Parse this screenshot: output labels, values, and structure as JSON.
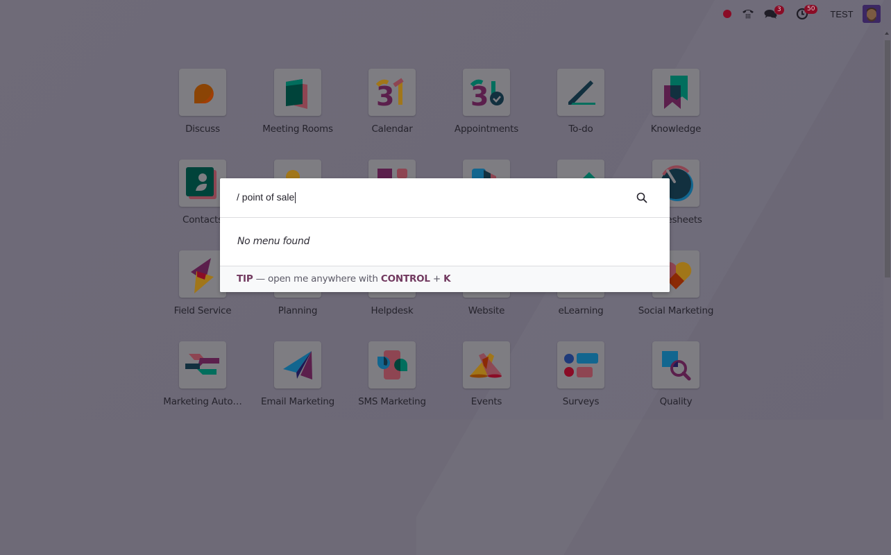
{
  "topbar": {
    "status_dot_color": "#8a0c26",
    "messages_badge": "3",
    "activities_badge": "50",
    "user_name": "TEST"
  },
  "apps": [
    {
      "label": "Discuss",
      "icon": "discuss-icon"
    },
    {
      "label": "Meeting Rooms",
      "icon": "meeting-rooms-icon"
    },
    {
      "label": "Calendar",
      "icon": "calendar-icon"
    },
    {
      "label": "Appointments",
      "icon": "appointments-icon"
    },
    {
      "label": "To-do",
      "icon": "todo-icon"
    },
    {
      "label": "Knowledge",
      "icon": "knowledge-icon"
    },
    {
      "label": "Contacts",
      "icon": "contacts-icon"
    },
    {
      "label": "",
      "icon": "app-icon"
    },
    {
      "label": "",
      "icon": "app-icon"
    },
    {
      "label": "",
      "icon": "app-icon"
    },
    {
      "label": "",
      "icon": "app-icon"
    },
    {
      "label": "Timesheets",
      "icon": "timesheets-icon"
    },
    {
      "label": "Field Service",
      "icon": "field-service-icon"
    },
    {
      "label": "Planning",
      "icon": "planning-icon"
    },
    {
      "label": "Helpdesk",
      "icon": "helpdesk-icon"
    },
    {
      "label": "Website",
      "icon": "website-icon"
    },
    {
      "label": "eLearning",
      "icon": "elearning-icon"
    },
    {
      "label": "Social Marketing",
      "icon": "social-marketing-icon"
    },
    {
      "label": "Marketing Auto…",
      "icon": "marketing-automation-icon"
    },
    {
      "label": "Email Marketing",
      "icon": "email-marketing-icon"
    },
    {
      "label": "SMS Marketing",
      "icon": "sms-marketing-icon"
    },
    {
      "label": "Events",
      "icon": "events-icon"
    },
    {
      "label": "Surveys",
      "icon": "surveys-icon"
    },
    {
      "label": "Quality",
      "icon": "quality-icon"
    }
  ],
  "command_palette": {
    "search_value": "/ point of sale",
    "no_result_text": "No menu found",
    "tip_label": "TIP",
    "tip_text": " — open me anywhere with ",
    "tip_key1": "CONTROL",
    "tip_plus": " + ",
    "tip_key2": "K"
  }
}
